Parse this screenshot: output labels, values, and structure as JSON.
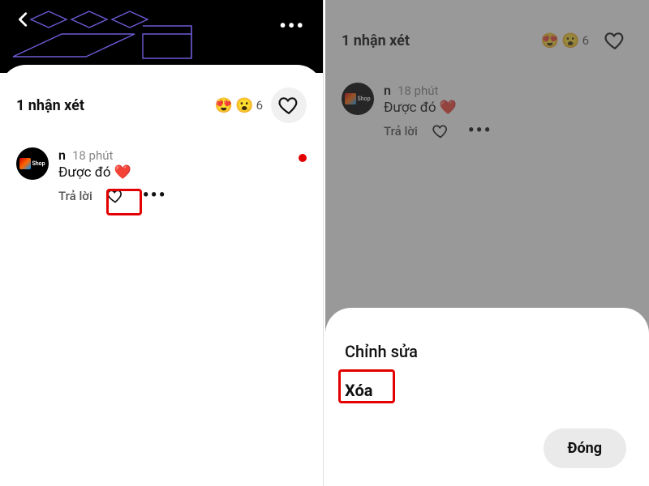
{
  "left": {
    "comments_title": "1 nhận xét",
    "reaction_count": "6",
    "comment": {
      "name": "n",
      "time": "18 phút",
      "text": "Được đó",
      "reply_label": "Trả lời"
    }
  },
  "right": {
    "comments_title": "1 nhận xét",
    "reaction_count": "6",
    "comment": {
      "name": "n",
      "time": "18 phút",
      "text": "Được đó",
      "reply_label": "Trả lời"
    },
    "menu": {
      "edit": "Chỉnh sửa",
      "delete": "Xóa",
      "close": "Đóng"
    }
  }
}
